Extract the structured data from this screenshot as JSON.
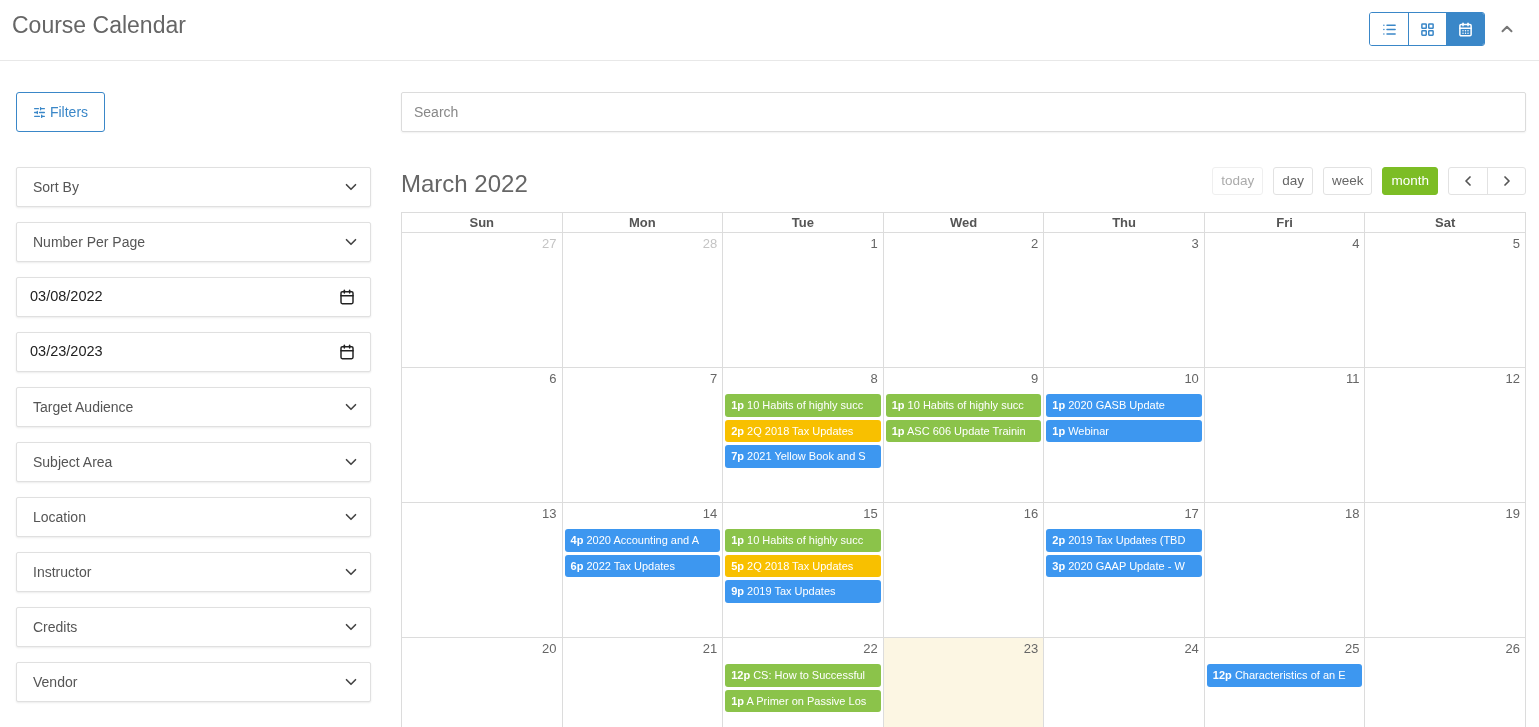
{
  "header": {
    "title": "Course Calendar",
    "view_toggle": [
      {
        "kind": "list",
        "selected": false
      },
      {
        "kind": "grid",
        "selected": false
      },
      {
        "kind": "calendar",
        "selected": true
      }
    ],
    "collapse": {
      "kind": "chevron-up"
    }
  },
  "sidebar": {
    "filters_button": {
      "label": "Filters"
    },
    "fields": [
      {
        "kind": "select",
        "label": "Sort By"
      },
      {
        "kind": "select",
        "label": "Number Per Page"
      },
      {
        "kind": "date",
        "value": "03/08/2022"
      },
      {
        "kind": "date",
        "value": "03/23/2023"
      },
      {
        "kind": "select",
        "label": "Target Audience"
      },
      {
        "kind": "select",
        "label": "Subject Area"
      },
      {
        "kind": "select",
        "label": "Location"
      },
      {
        "kind": "select",
        "label": "Instructor"
      },
      {
        "kind": "select",
        "label": "Credits"
      },
      {
        "kind": "select",
        "label": "Vendor"
      }
    ]
  },
  "search": {
    "placeholder": "Search"
  },
  "calendar": {
    "title": "March 2022",
    "nav_buttons": [
      {
        "label": "today",
        "disabled": true,
        "selected": false
      },
      {
        "label": "day",
        "disabled": false,
        "selected": false
      },
      {
        "label": "week",
        "disabled": false,
        "selected": false
      },
      {
        "label": "month",
        "disabled": false,
        "selected": true
      }
    ],
    "arrows": [
      {
        "kind": "prev"
      },
      {
        "kind": "next"
      }
    ],
    "weekdays": [
      "Sun",
      "Mon",
      "Tue",
      "Wed",
      "Thu",
      "Fri",
      "Sat"
    ],
    "weeks": [
      {
        "days": [
          {
            "day": "27",
            "other_month": true,
            "today": false
          },
          {
            "day": "28",
            "other_month": true,
            "today": false
          },
          {
            "day": "1",
            "other_month": false,
            "today": false
          },
          {
            "day": "2",
            "other_month": false,
            "today": false
          },
          {
            "day": "3",
            "other_month": false,
            "today": false
          },
          {
            "day": "4",
            "other_month": false,
            "today": false
          },
          {
            "day": "5",
            "other_month": false,
            "today": false
          }
        ]
      },
      {
        "days": [
          {
            "day": "6",
            "other_month": false,
            "today": false
          },
          {
            "day": "7",
            "other_month": false,
            "today": false
          },
          {
            "day": "8",
            "other_month": false,
            "today": false,
            "events": [
              {
                "time": "1p",
                "title": "10 Habits of highly succ",
                "color": "#8bc34a"
              },
              {
                "time": "2p",
                "title": "2Q 2018 Tax Updates",
                "color": "#f8c000"
              },
              {
                "time": "7p",
                "title": "2021 Yellow Book and S",
                "color": "#3d97f0"
              }
            ]
          },
          {
            "day": "9",
            "other_month": false,
            "today": false,
            "events": [
              {
                "time": "1p",
                "title": "10 Habits of highly succ",
                "color": "#8bc34a"
              },
              {
                "time": "1p",
                "title": "ASC 606 Update Trainin",
                "color": "#8bc34a"
              }
            ]
          },
          {
            "day": "10",
            "other_month": false,
            "today": false,
            "events": [
              {
                "time": "1p",
                "title": "2020 GASB Update",
                "color": "#3d97f0"
              },
              {
                "time": "1p",
                "title": "Webinar",
                "color": "#3d97f0"
              }
            ]
          },
          {
            "day": "11",
            "other_month": false,
            "today": false
          },
          {
            "day": "12",
            "other_month": false,
            "today": false
          }
        ]
      },
      {
        "days": [
          {
            "day": "13",
            "other_month": false,
            "today": false
          },
          {
            "day": "14",
            "other_month": false,
            "today": false,
            "events": [
              {
                "time": "4p",
                "title": "2020 Accounting and A",
                "color": "#3d97f0"
              },
              {
                "time": "6p",
                "title": "2022 Tax Updates",
                "color": "#3d97f0"
              }
            ]
          },
          {
            "day": "15",
            "other_month": false,
            "today": false,
            "events": [
              {
                "time": "1p",
                "title": "10 Habits of highly succ",
                "color": "#8bc34a"
              },
              {
                "time": "5p",
                "title": "2Q 2018 Tax Updates",
                "color": "#f8c000"
              },
              {
                "time": "9p",
                "title": "2019 Tax Updates",
                "color": "#3d97f0"
              }
            ]
          },
          {
            "day": "16",
            "other_month": false,
            "today": false
          },
          {
            "day": "17",
            "other_month": false,
            "today": false,
            "events": [
              {
                "time": "2p",
                "title": "2019 Tax Updates (TBD",
                "color": "#3d97f0"
              },
              {
                "time": "3p",
                "title": "2020 GAAP Update - W",
                "color": "#3d97f0"
              }
            ]
          },
          {
            "day": "18",
            "other_month": false,
            "today": false
          },
          {
            "day": "19",
            "other_month": false,
            "today": false
          }
        ]
      },
      {
        "days": [
          {
            "day": "20",
            "other_month": false,
            "today": false
          },
          {
            "day": "21",
            "other_month": false,
            "today": false
          },
          {
            "day": "22",
            "other_month": false,
            "today": false,
            "events": [
              {
                "time": "12p",
                "title": "CS: How to Successful",
                "color": "#8bc34a"
              },
              {
                "time": "1p",
                "title": "A Primer on Passive Los",
                "color": "#8bc34a"
              }
            ]
          },
          {
            "day": "23",
            "other_month": false,
            "today": true
          },
          {
            "day": "24",
            "other_month": false,
            "today": false
          },
          {
            "day": "25",
            "other_month": false,
            "today": false,
            "events": [
              {
                "time": "12p",
                "title": "Characteristics of an E",
                "color": "#3d97f0"
              }
            ]
          },
          {
            "day": "26",
            "other_month": false,
            "today": false
          }
        ]
      }
    ]
  }
}
